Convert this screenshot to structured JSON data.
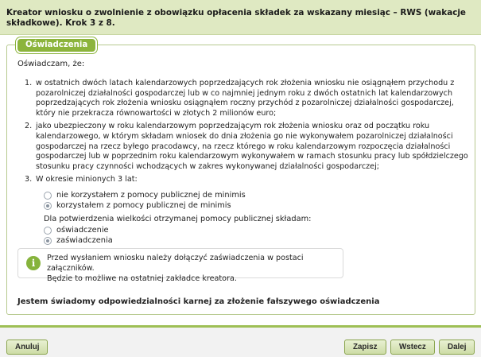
{
  "header": {
    "title": "Kreator wniosku o zwolnienie z obowiązku opłacenia składek za wskazany miesiąc – RWS (wakacje składkowe). Krok 3 z 8."
  },
  "panel": {
    "tab_label": "Oświadczenia",
    "intro": "Oświadczam, że:",
    "items": [
      {
        "num": "1.",
        "text": "w ostatnich dwóch latach kalendarzowych poprzedzających rok złożenia wniosku nie osiągnąłem przychodu z pozarolniczej działalności gospodarczej lub w co najmniej jednym roku z dwóch ostatnich lat kalendarzowych poprzedzających rok złożenia wniosku osiągnąłem roczny przychód z pozarolniczej działalności gospodarczej, który nie przekracza równowartości w złotych 2 milionów euro;"
      },
      {
        "num": "2.",
        "text": "jako ubezpieczony w roku kalendarzowym poprzedzającym rok złożenia wniosku oraz od początku roku kalendarzowego, w którym składam wniosek do dnia złożenia go nie wykonywałem pozarolniczej działalności gospodarczej na rzecz byłego pracodawcy, na rzecz którego w roku kalendarzowym rozpoczęcia działalności gospodarczej lub w poprzednim roku kalendarzowym wykonywałem w ramach stosunku pracy lub spółdzielczego stosunku pracy czynności wchodzących w zakres wykonywanej działalności gospodarczej;"
      },
      {
        "num": "3.",
        "text": "W okresie minionych 3 lat:"
      }
    ],
    "aid_options": [
      {
        "label": "nie korzystałem z pomocy publicznej de minimis",
        "selected": false
      },
      {
        "label": "korzystałem z pomocy publicznej de minimis",
        "selected": true
      }
    ],
    "confirm_label": "Dla potwierdzenia wielkości otrzymanej pomocy publicznej składam:",
    "confirm_options": [
      {
        "label": "oświadczenie",
        "selected": false
      },
      {
        "label": "zaświadczenia",
        "selected": true
      }
    ],
    "info_text_1": "Przed wysłaniem wniosku należy dołączyć zaświadczenia w postaci załączników.",
    "info_text_2": "Będzie to możliwe na ostatniej zakładce kreatora.",
    "declaration": "Jestem świadomy odpowiedzialności karnej za złożenie fałszywego oświadczenia"
  },
  "footer": {
    "cancel_label": "Anuluj",
    "save_label": "Zapisz",
    "back_label": "Wstecz",
    "next_label": "Dalej"
  },
  "colors": {
    "accent": "#8cb43c",
    "header_bg": "#dfe9c2",
    "button_bg": "#cddca6",
    "info_icon": "#86b33c"
  }
}
